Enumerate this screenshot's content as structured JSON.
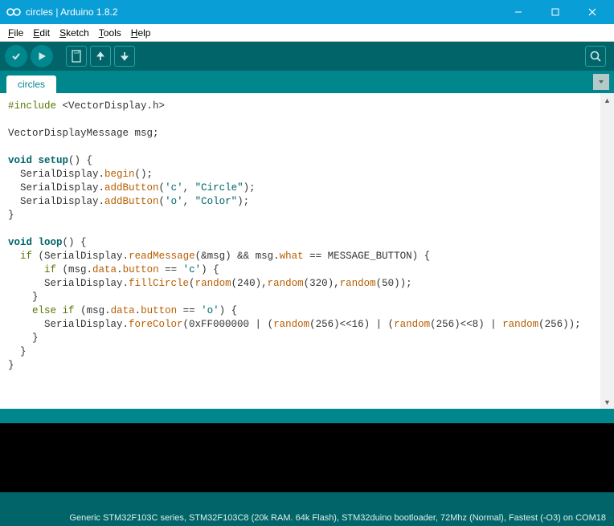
{
  "titlebar": {
    "title": "circles | Arduino 1.8.2"
  },
  "menubar": {
    "file": "File",
    "edit": "Edit",
    "sketch": "Sketch",
    "tools": "Tools",
    "help": "Help"
  },
  "tabs": {
    "active": "circles"
  },
  "footer": {
    "board": "Generic STM32F103C series, STM32F103C8 (20k RAM. 64k Flash), STM32duino bootloader, 72Mhz (Normal), Fastest (-O3) on COM18"
  },
  "code": {
    "l1a": "#include",
    "l1b": " <VectorDisplay.h>",
    "l3": "VectorDisplayMessage msg;",
    "l5a": "void",
    "l5b": " ",
    "l5c": "setup",
    "l5d": "() {",
    "l6a": "  SerialDisplay.",
    "l6b": "begin",
    "l6c": "();",
    "l7a": "  SerialDisplay.",
    "l7b": "addButton",
    "l7c": "(",
    "l7d": "'c'",
    "l7e": ", ",
    "l7f": "\"Circle\"",
    "l7g": ");",
    "l8a": "  SerialDisplay.",
    "l8b": "addButton",
    "l8c": "(",
    "l8d": "'o'",
    "l8e": ", ",
    "l8f": "\"Color\"",
    "l8g": ");",
    "l9": "}",
    "l11a": "void",
    "l11b": " ",
    "l11c": "loop",
    "l11d": "() {",
    "l12a": "  ",
    "l12b": "if",
    "l12c": " (SerialDisplay.",
    "l12d": "readMessage",
    "l12e": "(&msg) && msg.",
    "l12f": "what",
    "l12g": " == MESSAGE_BUTTON) {",
    "l13a": "      ",
    "l13b": "if",
    "l13c": " (msg.",
    "l13d": "data",
    "l13e": ".",
    "l13f": "button",
    "l13g": " == ",
    "l13h": "'c'",
    "l13i": ") {",
    "l14a": "      SerialDisplay.",
    "l14b": "fillCircle",
    "l14c": "(",
    "l14d": "random",
    "l14e": "(240),",
    "l14f": "random",
    "l14g": "(320),",
    "l14h": "random",
    "l14i": "(50));",
    "l15": "    }",
    "l16a": "    ",
    "l16b": "else",
    "l16c": " ",
    "l16d": "if",
    "l16e": " (msg.",
    "l16f": "data",
    "l16g": ".",
    "l16h": "button",
    "l16i": " == ",
    "l16j": "'o'",
    "l16k": ") {",
    "l17a": "      SerialDisplay.",
    "l17b": "foreColor",
    "l17c": "(0xFF000000 | (",
    "l17d": "random",
    "l17e": "(256)<<16) | (",
    "l17f": "random",
    "l17g": "(256)<<8) | ",
    "l17h": "random",
    "l17i": "(256));",
    "l18": "    }",
    "l19": "  }",
    "l20": "}"
  }
}
